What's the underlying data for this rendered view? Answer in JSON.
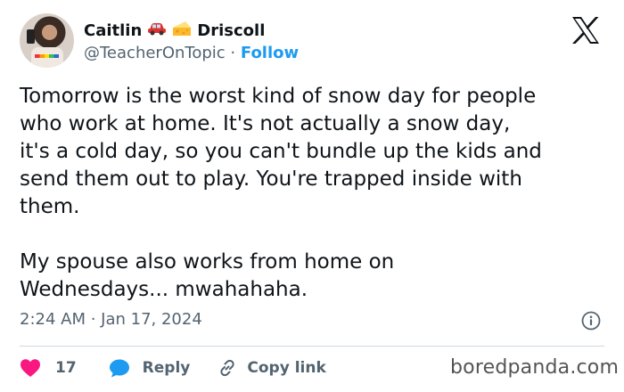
{
  "author": {
    "first_name": "Caitlin",
    "last_name": "Driscoll",
    "name_emojis": [
      "car-emoji",
      "cheese-emoji"
    ],
    "handle": "@TeacherOnTopic",
    "separator": "·",
    "follow_label": "Follow"
  },
  "post": {
    "paragraph_1_lines": [
      "Tomorrow is the worst kind of snow day for people",
      "who work at home. It's not actually a snow day,",
      "it's a cold day, so you can't bundle up the kids and",
      "send them out to play. You're trapped inside with",
      "them."
    ],
    "paragraph_2_lines": [
      "My spouse also works from home on",
      "Wednesdays... mwahahaha."
    ],
    "timestamp": "2:24 AM · Jan 17, 2024"
  },
  "actions": {
    "like_count": "17",
    "reply_label": "Reply",
    "copy_link_label": "Copy link"
  },
  "colors": {
    "text": "#0f1419",
    "secondary_text": "#536471",
    "accent_blue": "#1d9bf0",
    "heart_pink": "#f91880",
    "divider": "#cfd9de"
  },
  "icons": [
    "x-logo-icon",
    "info-icon",
    "heart-icon",
    "reply-bubble-icon",
    "link-icon"
  ],
  "watermark": "boredpanda.com"
}
